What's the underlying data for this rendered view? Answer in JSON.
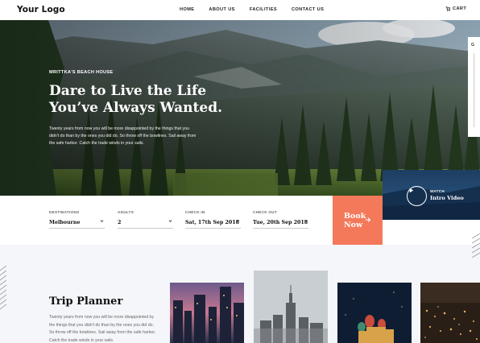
{
  "header": {
    "logo": "Your Logo",
    "nav": [
      "HOME",
      "ABOUT US",
      "FACILITIES",
      "CONTACT US"
    ],
    "cart_label": "CART",
    "cart_icon": "cart-icon"
  },
  "hero": {
    "eyebrow": "MRITTKA'S BEACH HOUSE",
    "headline_line1": "Dare to Live the Life",
    "headline_line2": "You’ve Always Wanted.",
    "description": "Twenty years from now you will be more disappointed by the things that you didn't do than by the ones you did do. So throw off the bowlines. Sail away from the safe harbor. Catch the trade winds in your sails."
  },
  "side_widget": {
    "label": "G"
  },
  "video": {
    "small_label": "WATCH",
    "big_label": "Intro Video",
    "icon": "play-icon"
  },
  "booking": {
    "fields": [
      {
        "label": "DESTINATIONS",
        "value": "Melbourne"
      },
      {
        "label": "ADULTS",
        "value": "2"
      },
      {
        "label": "CHECK IN",
        "value": "Sat, 17th Sep 2018"
      },
      {
        "label": "CHECK OUT",
        "value": "Tue, 20th Sep 2018"
      }
    ],
    "button_line1": "Book",
    "button_line2": "Now",
    "accent_color": "#f4795a"
  },
  "trip_planner": {
    "title": "Trip Planner",
    "description": "Twenty years from now you will be more disappointed by the things that you didn't do than by the ones you did do. So throw off the bowlines. Sail away from the safe harbor. Catch the trade winds in your sails."
  },
  "destination_cards": [
    "city-skyline-dusk",
    "empire-state-skyline",
    "night-cathedral",
    "night-city-lights"
  ]
}
